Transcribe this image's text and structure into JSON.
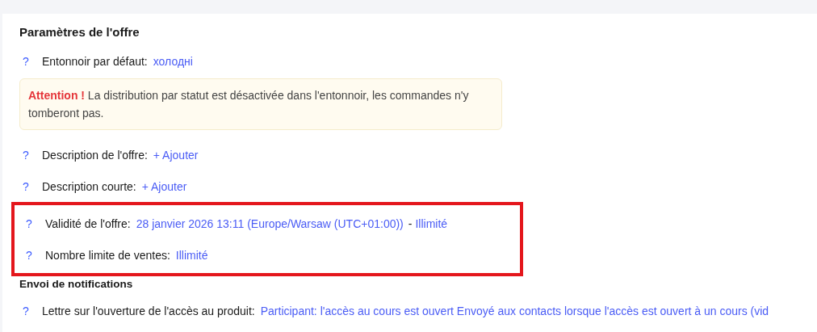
{
  "blocks": [
    {
      "kind": "heading",
      "text": "Paramètres de l'offre"
    },
    {
      "kind": "row",
      "help": "?",
      "label": "Entonnoir par défaut:",
      "parts": [
        {
          "kind": "link",
          "text": "холодні"
        }
      ]
    },
    {
      "kind": "notice",
      "emphasis": "Attention !",
      "text": "La distribution par statut est désactivée dans l'entonnoir, les commandes n'y tomberont pas."
    },
    {
      "kind": "row",
      "help": "?",
      "label": "Description de l'offre:",
      "parts": [
        {
          "kind": "link",
          "text": "+ Ajouter"
        }
      ]
    },
    {
      "kind": "row",
      "help": "?",
      "label": "Description courte:",
      "parts": [
        {
          "kind": "link",
          "text": "+ Ajouter"
        }
      ]
    },
    {
      "kind": "highlight",
      "rows": [
        {
          "help": "?",
          "label": "Validité de l'offre:",
          "parts": [
            {
              "kind": "link",
              "text": "28 janvier 2026 13:11 (Europe/Warsaw (UTC+01:00))"
            },
            {
              "kind": "plain",
              "text": "-"
            },
            {
              "kind": "link",
              "text": "Illimité"
            }
          ]
        },
        {
          "help": "?",
          "label": "Nombre limite de ventes:",
          "parts": [
            {
              "kind": "link",
              "text": "Illimité"
            }
          ]
        }
      ]
    },
    {
      "kind": "subheading",
      "text": "Envoi de notifications"
    },
    {
      "kind": "row",
      "help": "?",
      "label": "Lettre sur l'ouverture de l'accès au produit:",
      "parts": [
        {
          "kind": "link",
          "text": "Participant: l'accès au cours est ouvert Envoyé aux contacts lorsque l'accès est ouvert à un cours (vid"
        }
      ]
    }
  ]
}
